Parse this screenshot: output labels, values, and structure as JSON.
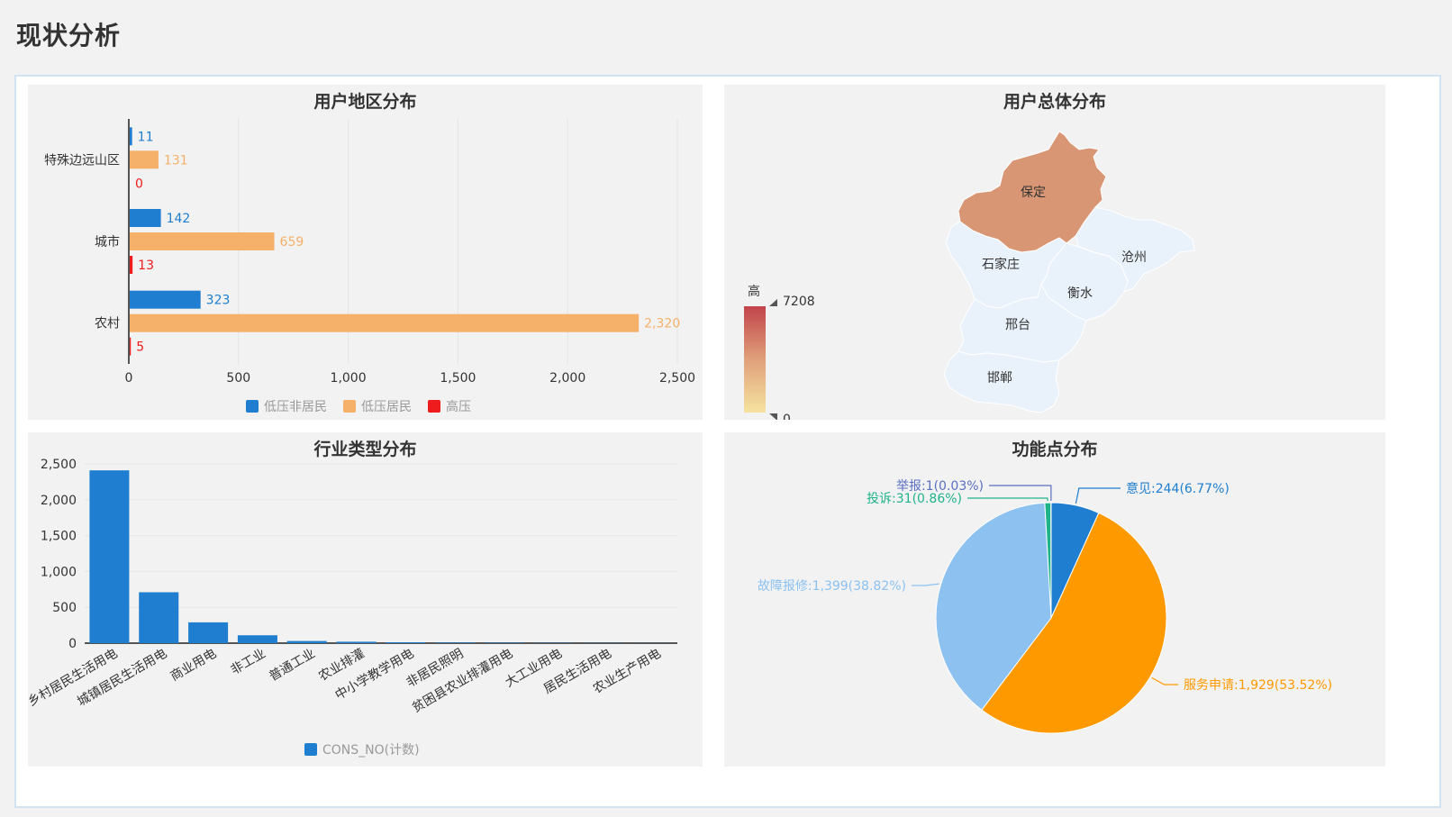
{
  "page": {
    "title": "现状分析"
  },
  "region_chart": {
    "title": "用户地区分布",
    "chart_data": {
      "type": "bar",
      "orientation": "horizontal",
      "categories": [
        "特殊边远山区",
        "城市",
        "农村"
      ],
      "series": [
        {
          "name": "低压非居民",
          "color": "#1f7ecf",
          "values": [
            11,
            142,
            323
          ]
        },
        {
          "name": "低压居民",
          "color": "#f5b16a",
          "values": [
            131,
            659,
            2320
          ]
        },
        {
          "name": "高压",
          "color": "#ee1c1c",
          "values": [
            0,
            13,
            5
          ]
        }
      ],
      "value_labels": [
        [
          "11",
          "131",
          "0"
        ],
        [
          "142",
          "659",
          "13"
        ],
        [
          "323",
          "2,320",
          "5"
        ]
      ],
      "xlim": [
        0,
        2500
      ],
      "xticks": [
        "0",
        "500",
        "1,000",
        "1,500",
        "2,000",
        "2,500"
      ],
      "legend": "bottom"
    }
  },
  "map_chart": {
    "title": "用户总体分布",
    "legend": {
      "high_label": "高",
      "max": "7208",
      "min": "0"
    },
    "regions": [
      {
        "name": "保定",
        "level": "high",
        "color": "#d99674"
      },
      {
        "name": "石家庄",
        "level": "low",
        "color": "#e9f2fb"
      },
      {
        "name": "沧州",
        "level": "low",
        "color": "#e9f2fb"
      },
      {
        "name": "衡水",
        "level": "low",
        "color": "#e9f2fb"
      },
      {
        "name": "邢台",
        "level": "low",
        "color": "#e9f2fb"
      },
      {
        "name": "邯郸",
        "level": "low",
        "color": "#e9f2fb"
      }
    ]
  },
  "industry_chart": {
    "title": "行业类型分布",
    "chart_data": {
      "type": "bar",
      "categories": [
        "乡村居民生活用电",
        "城镇居民生活用电",
        "商业用电",
        "非工业",
        "普通工业",
        "农业排灌",
        "中小学教学用电",
        "非居民照明",
        "贫困县农业排灌用电",
        "大工业用电",
        "居民生活用电",
        "农业生产用电"
      ],
      "series": [
        {
          "name": "CONS_NO(计数)",
          "color": "#1f7ecf",
          "values": [
            2410,
            710,
            290,
            110,
            30,
            20,
            12,
            8,
            6,
            4,
            3,
            2
          ]
        }
      ],
      "ylim": [
        0,
        2500
      ],
      "yticks": [
        "0",
        "500",
        "1,000",
        "1,500",
        "2,000",
        "2,500"
      ],
      "legend": "bottom"
    }
  },
  "function_chart": {
    "title": "功能点分布",
    "chart_data": {
      "type": "pie",
      "slices": [
        {
          "name": "意见",
          "value": 244,
          "percent": 6.77,
          "color": "#1f7ecf",
          "label": "意见:244(6.77%)"
        },
        {
          "name": "服务申请",
          "value": 1929,
          "percent": 53.52,
          "color": "#ff9900",
          "label": "服务申请:1,929(53.52%)"
        },
        {
          "name": "故障报修",
          "value": 1399,
          "percent": 38.82,
          "color": "#8cc1f0",
          "label": "故障报修:1,399(38.82%)"
        },
        {
          "name": "投诉",
          "value": 31,
          "percent": 0.86,
          "color": "#1fb38a",
          "label": "投诉:31(0.86%)"
        },
        {
          "name": "举报",
          "value": 1,
          "percent": 0.03,
          "color": "#5a6fc0",
          "label": "举报:1(0.03%)"
        }
      ]
    }
  }
}
